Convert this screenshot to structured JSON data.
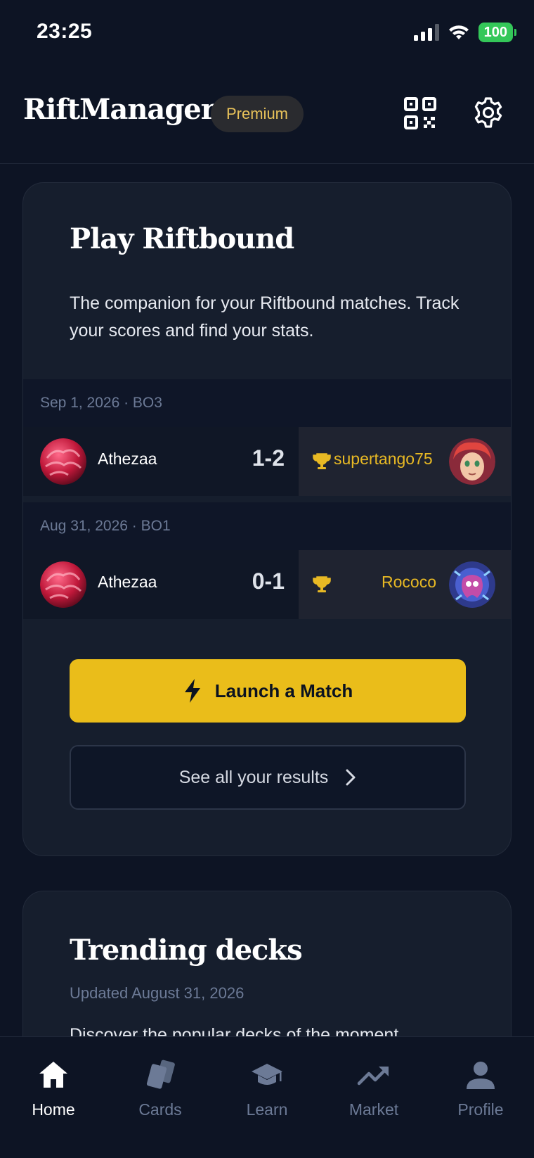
{
  "status_bar": {
    "time": "23:25",
    "battery": "100"
  },
  "app_bar": {
    "title": "RiftManager",
    "badge": "Premium"
  },
  "play_card": {
    "title": "Play Riftbound",
    "description": "The companion for your Riftbound matches. Track your scores and find your stats.",
    "matches": [
      {
        "date": "Sep 1, 2026 · BO3",
        "player": "Athezaa",
        "score": "1-2",
        "opponent": "supertango75"
      },
      {
        "date": "Aug 31, 2026 · BO1",
        "player": "Athezaa",
        "score": "0-1",
        "opponent": "Rococo"
      }
    ],
    "launch_label": "Launch a Match",
    "results_label": "See all your results"
  },
  "trending_card": {
    "title": "Trending decks",
    "updated": "Updated August 31, 2026",
    "teaser": "Discover the popular decks of the moment"
  },
  "tab_bar": {
    "items": [
      {
        "label": "Home",
        "icon": "home-icon"
      },
      {
        "label": "Cards",
        "icon": "cards-icon"
      },
      {
        "label": "Learn",
        "icon": "graduation-cap-icon"
      },
      {
        "label": "Market",
        "icon": "trending-up-icon"
      },
      {
        "label": "Profile",
        "icon": "person-icon"
      }
    ]
  },
  "colors": {
    "accent": "#eabd1a",
    "winner": "#e8b924",
    "background": "#0d1424",
    "card": "#161e2d"
  }
}
